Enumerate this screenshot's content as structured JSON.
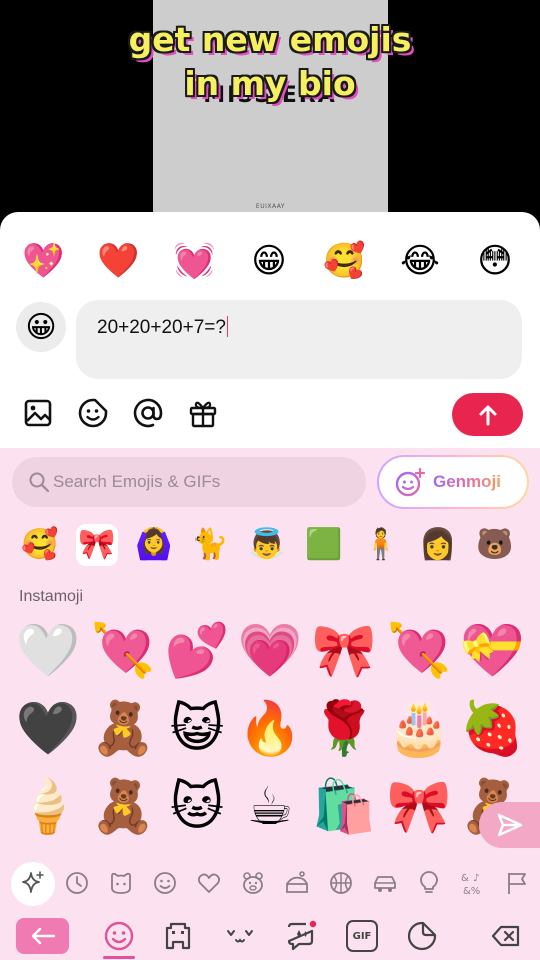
{
  "video": {
    "caption_line1": "get new emojis",
    "caption_line2": "in my bio",
    "background_word": "MISS ERA",
    "brand": "EUIXAAY"
  },
  "quick_reactions": [
    "💖",
    "❤️",
    "💓",
    "😁",
    "🥰",
    "😂",
    "😳"
  ],
  "composer": {
    "text": "20+20+20+7=?",
    "avatar_emoji": "😀"
  },
  "toolbar": {
    "icons": [
      "image-icon",
      "sticker-icon",
      "mention-icon",
      "gift-icon"
    ],
    "send_icon": "arrow-up-icon",
    "send_color": "#e8254f"
  },
  "keyboard": {
    "search_placeholder": "Search Emojis & GIFs",
    "genmoji_label": "Genmoji",
    "packs": [
      "🥰",
      "🎀",
      "🙆‍♀️",
      "🐈",
      "👼",
      "🟩",
      "🧍",
      "👩",
      "🐻"
    ],
    "section_title": "Instamoji",
    "grid": [
      [
        "🤍",
        "💘",
        "💕",
        "💗",
        "🎀",
        "💘",
        "💝"
      ],
      [
        "🖤",
        "🧸",
        "😺",
        "🔥",
        "🌹",
        "🎂",
        "🍓"
      ],
      [
        "🍦",
        "🧸",
        "🐱",
        "☕",
        "🛍️",
        "🎀",
        "🧸"
      ]
    ],
    "categories": [
      "sparkle-icon",
      "clock-icon",
      "smiley-icon",
      "heart-icon",
      "animal-icon",
      "food-icon",
      "ball-icon",
      "car-icon",
      "bulb-icon",
      "symbols-icon",
      "flag-icon"
    ],
    "bottom_icons": [
      "abc-back-icon",
      "emoji-tab-icon",
      "pixel-icon",
      "kaomoji-icon",
      "ai-sticker-icon",
      "gif-icon",
      "sticker-tab-icon",
      "backspace-icon"
    ],
    "gif_label": "GIF",
    "accent": "#f07ab2"
  }
}
